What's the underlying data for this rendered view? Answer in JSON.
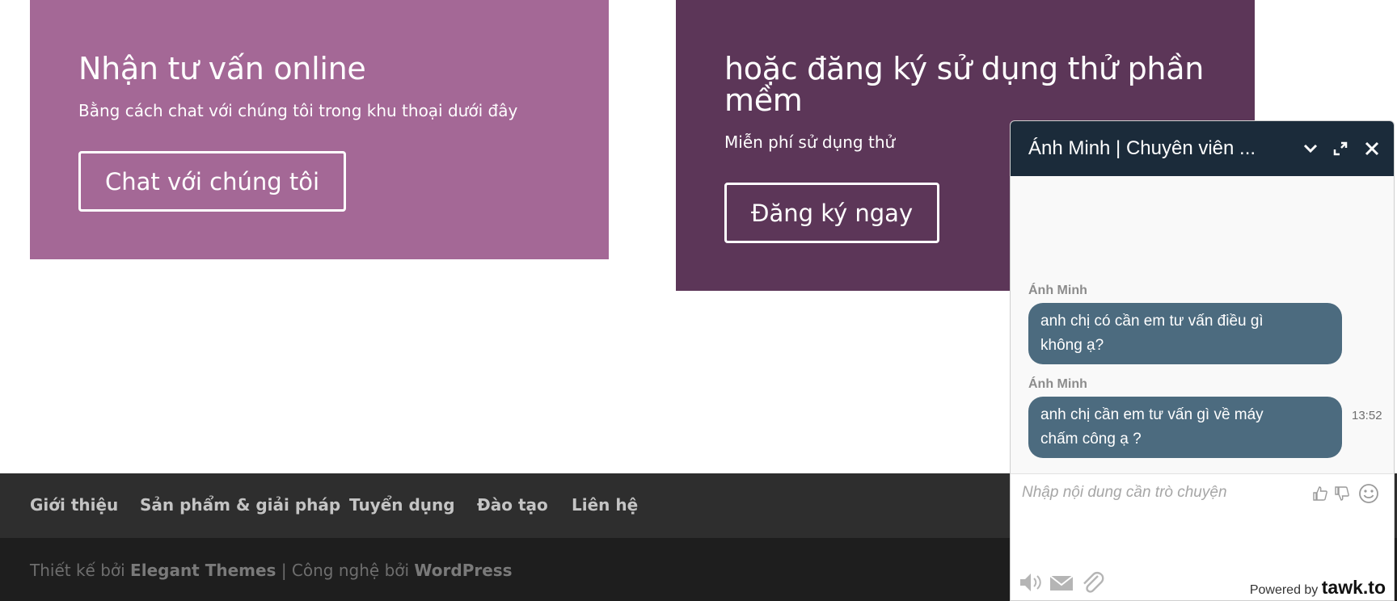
{
  "panels": {
    "left": {
      "title": "Nhận tư vấn online",
      "subtitle": "Bằng cách chat với chúng tôi trong khu thoại dưới đây",
      "button": "Chat với chúng tôi"
    },
    "right": {
      "title_line1": "hoặc đăng ký sử dụng thử phần",
      "title_line2": "mềm",
      "subtitle": "Miễn phí sử dụng thử",
      "button": "Đăng ký ngay"
    }
  },
  "footer": {
    "nav": [
      "Giới thiệu",
      "Sản phẩm & giải pháp",
      "Tuyển dụng",
      "Đào tạo",
      "Liên hệ"
    ],
    "credits_prefix": "Thiết kế bởi",
    "credits_theme": "Elegant Themes",
    "credits_separator": "| Công nghệ bởi",
    "credits_platform": "WordPress"
  },
  "chat": {
    "title": "Ánh Minh | Chuyên viên ...",
    "header_icons": [
      "chevron-down-icon",
      "popout-icon",
      "close-icon"
    ],
    "messages": [
      {
        "sender": "Ánh Minh",
        "line1": "anh chị có cần em tư vấn điều gì",
        "line2": "không ạ?"
      },
      {
        "sender": "Ánh Minh",
        "line1": "anh chị cần em tư vấn gì về máy",
        "line2": "chấm công ạ ?",
        "time": "13:52"
      }
    ],
    "input_placeholder": "Nhập nội dung cần trò chuyện",
    "powered_prefix": "Powered by",
    "powered_brand": "tawk.to",
    "colors": {
      "header": "#1b2b3a",
      "bubble": "#4c6b7f",
      "panel_left": "#a46896",
      "panel_right": "#5c3658"
    }
  }
}
